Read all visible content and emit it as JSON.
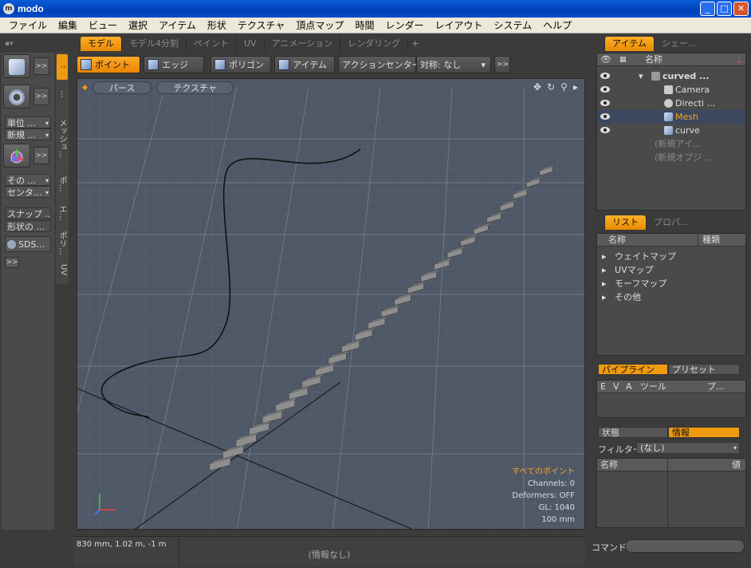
{
  "window": {
    "title": "modo",
    "icon": "modo-logo-icon"
  },
  "menu": [
    "ファイル",
    "編集",
    "ビュー",
    "選択",
    "アイテム",
    "形状",
    "テクスチャ",
    "頂点マップ",
    "時間",
    "レンダー",
    "レイアウト",
    "システム",
    "ヘルプ"
  ],
  "layout_tabs": [
    "モデル",
    "モデル4分割",
    "ペイント",
    "UV",
    "アニメーション",
    "レンダリング",
    "+"
  ],
  "right_tabs": [
    "アイテム",
    "シェー..."
  ],
  "left_tools": {
    "units": "単位 ...",
    "new": "新規 ...",
    "other": "その ...",
    "center": "センタ...",
    "snap": "スナップ ...",
    "shape": "形状の ...",
    "sds": "SDS...",
    "more": ">>"
  },
  "vertical_tabs": [
    ":",
    "...",
    "メッシュ...",
    "ポ...",
    "エ...",
    "ポリ...",
    "UV"
  ],
  "viewport_toolbar": {
    "point": "ポイント",
    "edge": "エッジ",
    "polygon": "ポリゴン",
    "item": "アイテム",
    "action_center": "アクションセンター",
    "symmetry": "対称: なし",
    "more": ">>"
  },
  "viewport": {
    "perspective": "パース",
    "texture": "テクスチャ",
    "info": {
      "all_points": "すべてのポイント",
      "channels": "Channels: 0",
      "deformers": "Deformers: OFF",
      "gl": "GL: 1040",
      "grid": "100 mm"
    }
  },
  "status": {
    "coords": "830 mm, 1.02 m, -1 m",
    "message": "(情報なし)"
  },
  "items_panel": {
    "name_header": "名称",
    "items": [
      {
        "label": "curved ...",
        "type": "scene"
      },
      {
        "label": "Camera",
        "type": "camera"
      },
      {
        "label": "Directi ...",
        "type": "light"
      },
      {
        "label": "Mesh",
        "type": "mesh",
        "selected": true
      },
      {
        "label": "curve",
        "type": "mesh"
      },
      {
        "label": "(新規アイ...",
        "type": "placeholder"
      },
      {
        "label": "(新規オブジ ...",
        "type": "placeholder"
      }
    ]
  },
  "list_panel": {
    "tabs": [
      "リスト",
      "プロパ..."
    ],
    "headers": [
      "名称",
      "種類"
    ],
    "rows": [
      "ウェイトマップ",
      "UVマップ",
      "モーフマップ",
      "その他"
    ]
  },
  "pipeline_panel": {
    "tabs": [
      "パイプライン",
      "プリセット"
    ],
    "headers": [
      "E",
      "V",
      "A",
      "ツール",
      "プ..."
    ]
  },
  "info_panel": {
    "tabs": [
      "状態",
      "情報"
    ],
    "filter_label": "フィルター",
    "filter_value": "(なし)",
    "headers": [
      "名称",
      "値"
    ]
  },
  "command": {
    "label": "コマンド",
    "value": ""
  },
  "colors": {
    "accent": "#f09a10",
    "viewport_bg": "#4f5866",
    "chrome": "#3b3b3b"
  }
}
